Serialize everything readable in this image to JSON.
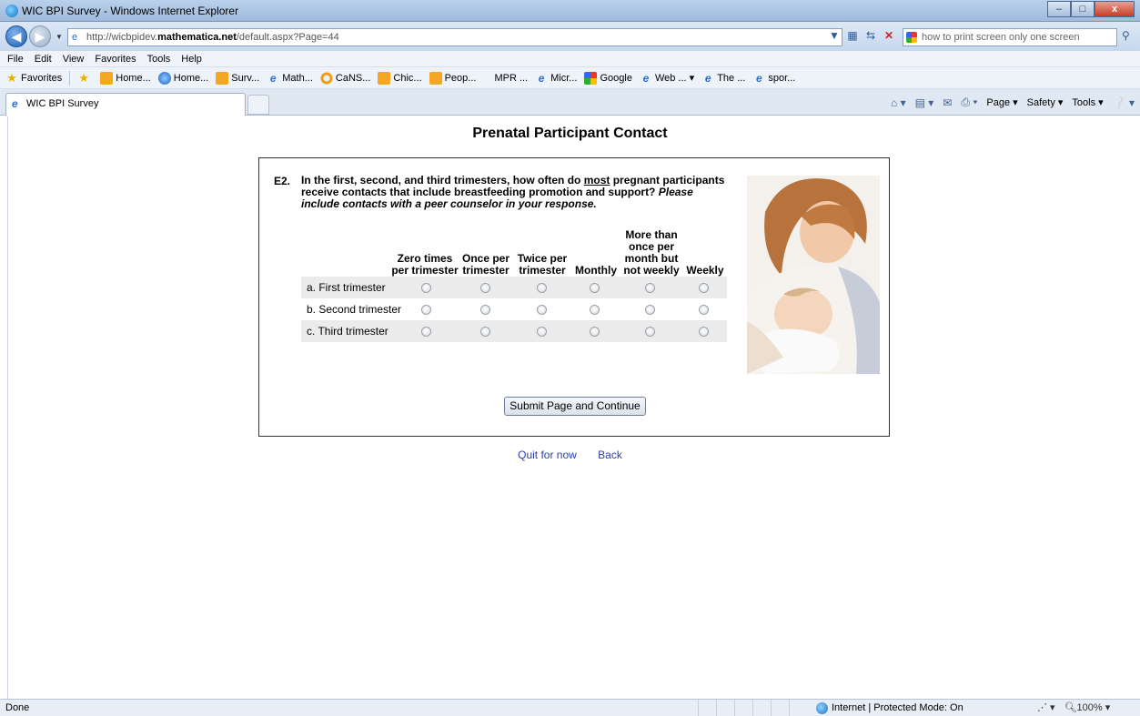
{
  "window": {
    "title": "WIC BPI Survey - Windows Internet Explorer",
    "min": "–",
    "max": "□",
    "close": "x"
  },
  "address": {
    "url_prefix": "http://wicbpidev.",
    "url_domain": "mathematica.net",
    "url_suffix": "/default.aspx?Page=44",
    "search_text": "how to print screen only one screen"
  },
  "menu": [
    "File",
    "Edit",
    "View",
    "Favorites",
    "Tools",
    "Help"
  ],
  "favorites": {
    "label": "Favorites",
    "items": [
      "Home...",
      "Home...",
      "Surv...",
      "Math...",
      "CaNS...",
      "Chic...",
      "Peop...",
      "MPR ...",
      "Micr...",
      "Google",
      "Web ... ▾",
      "The ...",
      "spor..."
    ]
  },
  "tab": {
    "label": "WIC BPI Survey"
  },
  "commandbar": {
    "page": "Page ▾",
    "safety": "Safety ▾",
    "tools": "Tools ▾"
  },
  "page": {
    "title": "Prenatal Participant Contact"
  },
  "question": {
    "number": "E2.",
    "text_part1": "In the first, second, and third trimesters, how often do ",
    "text_underlined": "most",
    "text_part2": " pregnant participants receive contacts that include breastfeeding promotion and support? ",
    "text_italic": "Please include contacts with a peer counselor in your response.",
    "columns": [
      "Zero times per trimester",
      "Once per trimester",
      "Twice per trimester",
      "Monthly",
      "More than once per month but not weekly",
      "Weekly"
    ],
    "rows": [
      "a. First trimester",
      "b. Second trimester",
      "c. Third trimester"
    ]
  },
  "buttons": {
    "submit": "Submit Page and Continue"
  },
  "links": {
    "quit": "Quit for now",
    "back": "Back"
  },
  "status": {
    "text": "Done",
    "zone": "Internet | Protected Mode: On",
    "zoom": "100%"
  }
}
